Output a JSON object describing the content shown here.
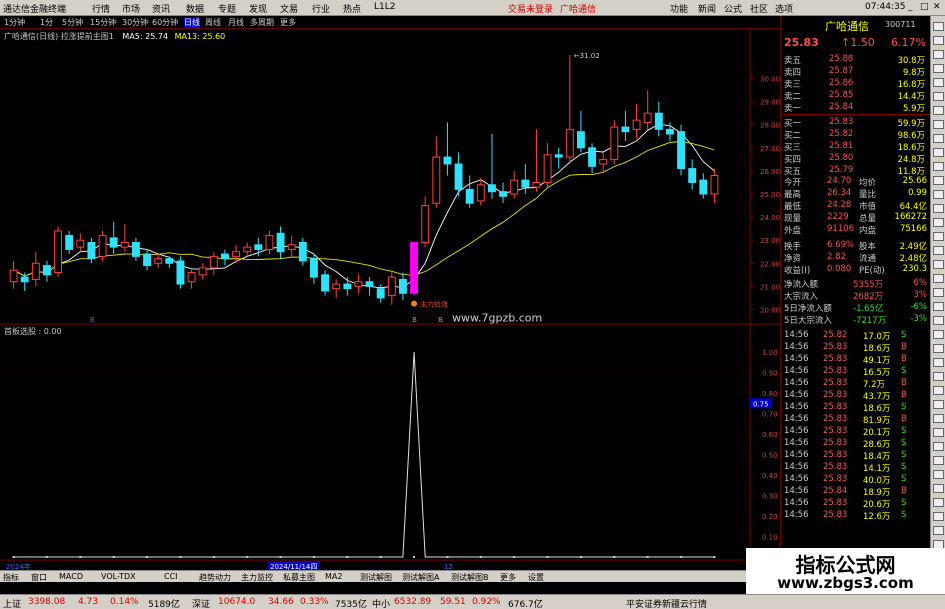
{
  "topbar": {
    "app": "通达信金融终端",
    "menu": [
      "行情",
      "市场",
      "资讯",
      "数据",
      "专题",
      "发现",
      "文易",
      "行业",
      "热点",
      "L1L2"
    ],
    "trade": "交易未登录",
    "stock": "广哈通信",
    "right": [
      "功能",
      "新闻",
      "公式",
      "社区",
      "选项"
    ],
    "clock": "07:44:35"
  },
  "tf": {
    "items": [
      "1分钟",
      "1分",
      "5分钟",
      "15分钟",
      "30分钟",
      "60分钟",
      "日线",
      "周线",
      "月线",
      "多周期",
      "更多"
    ],
    "active": "日线"
  },
  "chart_title": {
    "text": "广哈通信(日线) 拉涨提前主图1",
    "ma5": "MA5: 25.74",
    "ma13": "MA13: 25.60"
  },
  "chart_data": {
    "type": "candlestick",
    "ylim": [
      19.5,
      31.8
    ],
    "high_label": "31.02",
    "yticks": [
      "30.00",
      "29.00",
      "28.00",
      "27.00",
      "26.00",
      "25.00",
      "24.00",
      "23.00",
      "22.00",
      "21.00",
      "20.00"
    ],
    "candles": [
      [
        21.2,
        21.7,
        20.9,
        22.1
      ],
      [
        21.4,
        21.2,
        20.8,
        21.6
      ],
      [
        21.3,
        22.0,
        21.0,
        22.5
      ],
      [
        21.9,
        21.5,
        21.2,
        22.1
      ],
      [
        21.6,
        23.4,
        21.4,
        23.6
      ],
      [
        23.2,
        22.6,
        22.4,
        23.4
      ],
      [
        22.7,
        23.0,
        22.5,
        23.3
      ],
      [
        22.9,
        22.2,
        22.0,
        23.1
      ],
      [
        22.3,
        23.2,
        22.1,
        23.4
      ],
      [
        23.1,
        22.7,
        22.4,
        23.8
      ],
      [
        22.7,
        22.9,
        22.5,
        23.7
      ],
      [
        22.9,
        22.3,
        22.1,
        23.1
      ],
      [
        22.4,
        21.9,
        21.7,
        22.6
      ],
      [
        22.0,
        22.2,
        21.8,
        22.4
      ],
      [
        22.2,
        22.0,
        21.8,
        22.3
      ],
      [
        22.1,
        21.1,
        20.9,
        22.3
      ],
      [
        21.2,
        21.6,
        20.9,
        21.8
      ],
      [
        21.5,
        21.8,
        21.3,
        22.0
      ],
      [
        21.8,
        22.3,
        21.5,
        22.5
      ],
      [
        22.4,
        22.2,
        21.9,
        22.6
      ],
      [
        22.3,
        22.5,
        22.0,
        22.8
      ],
      [
        22.5,
        22.7,
        22.3,
        22.9
      ],
      [
        22.8,
        22.6,
        22.3,
        23.1
      ],
      [
        22.6,
        23.2,
        22.4,
        23.4
      ],
      [
        23.3,
        22.5,
        22.2,
        23.6
      ],
      [
        22.6,
        22.8,
        22.3,
        23.2
      ],
      [
        22.9,
        22.1,
        21.9,
        23.1
      ],
      [
        22.2,
        21.4,
        21.1,
        22.4
      ],
      [
        21.5,
        20.8,
        20.6,
        21.7
      ],
      [
        20.9,
        21.1,
        20.5,
        21.3
      ],
      [
        21.1,
        20.9,
        20.6,
        21.4
      ],
      [
        21.0,
        21.2,
        20.7,
        21.5
      ],
      [
        21.2,
        21.0,
        20.6,
        21.4
      ],
      [
        20.9,
        20.5,
        20.3,
        21.1
      ],
      [
        20.6,
        21.4,
        20.2,
        21.6
      ],
      [
        21.3,
        20.7,
        20.4,
        21.6
      ],
      [
        20.7,
        22.9,
        20.6,
        22.9
      ],
      [
        22.9,
        24.5,
        22.7,
        24.9
      ],
      [
        24.6,
        26.6,
        24.4,
        27.5
      ],
      [
        26.6,
        26.3,
        25.8,
        28.1
      ],
      [
        26.3,
        25.2,
        24.9,
        26.8
      ],
      [
        25.2,
        24.6,
        24.4,
        25.8
      ],
      [
        24.7,
        25.4,
        24.5,
        25.7
      ],
      [
        25.4,
        25.1,
        24.8,
        27.6
      ],
      [
        25.1,
        24.9,
        24.6,
        25.5
      ],
      [
        25.0,
        25.6,
        24.8,
        26.0
      ],
      [
        25.6,
        25.3,
        25.0,
        26.3
      ],
      [
        25.3,
        25.5,
        25.1,
        27.8
      ],
      [
        25.5,
        26.7,
        25.3,
        27.2
      ],
      [
        26.7,
        26.6,
        26.1,
        27.0
      ],
      [
        26.6,
        27.8,
        26.3,
        31.02
      ],
      [
        27.7,
        27.0,
        26.8,
        28.6
      ],
      [
        27.0,
        26.2,
        25.9,
        27.2
      ],
      [
        26.3,
        26.5,
        25.9,
        26.8
      ],
      [
        26.5,
        27.9,
        26.3,
        28.2
      ],
      [
        27.9,
        27.7,
        27.3,
        28.6
      ],
      [
        27.8,
        28.2,
        27.4,
        28.9
      ],
      [
        28.1,
        28.5,
        27.8,
        29.5
      ],
      [
        28.5,
        27.8,
        27.5,
        29.0
      ],
      [
        27.8,
        27.6,
        27.3,
        28.1
      ],
      [
        27.7,
        26.1,
        25.8,
        28.0
      ],
      [
        26.1,
        25.5,
        25.2,
        26.5
      ],
      [
        25.6,
        25.0,
        24.8,
        25.9
      ],
      [
        25.0,
        25.8,
        24.6,
        26.1
      ]
    ],
    "ind_yticks": [
      "1.00",
      "0.90",
      "0.80",
      "0.70",
      "0.60",
      "0.50",
      "0.40",
      "0.30",
      "0.20",
      "0.10"
    ],
    "ind_cursor": "0.75",
    "signal_index": 36,
    "signal_value": 1.0
  },
  "chart_text": {
    "signal": "主力拉涨",
    "site": "www.7gpzb.com",
    "marker1": "B",
    "marker2": "B",
    "marker3": "B"
  },
  "ind_title": {
    "text": "首板选股 : 0.00"
  },
  "dates": {
    "d1": "2024年",
    "d2": "2024/11/14四",
    "d3": "12"
  },
  "quote": {
    "name": "广哈通信",
    "code": "300711",
    "price": "25.83",
    "chg": "↑1.50",
    "pct": "6.17%"
  },
  "order_book": [
    {
      "l": "卖五",
      "p": "25.88",
      "v": "30.8万"
    },
    {
      "l": "卖四",
      "p": "25.87",
      "v": "9.8万"
    },
    {
      "l": "卖三",
      "p": "25.86",
      "v": "16.8万"
    },
    {
      "l": "卖二",
      "p": "25.85",
      "v": "14.4万"
    },
    {
      "l": "卖一",
      "p": "25.84",
      "v": "5.9万"
    },
    {
      "l": "买一",
      "p": "25.83",
      "v": "59.9万"
    },
    {
      "l": "买二",
      "p": "25.82",
      "v": "98.6万"
    },
    {
      "l": "买三",
      "p": "25.81",
      "v": "18.6万"
    },
    {
      "l": "买四",
      "p": "25.80",
      "v": "24.8万"
    },
    {
      "l": "买五",
      "p": "25.79",
      "v": "11.8万"
    }
  ],
  "stats": [
    {
      "l1": "今开",
      "v1": "24.70",
      "l2": "均价",
      "v2": "25.66"
    },
    {
      "l1": "最高",
      "v1": "26.34",
      "l2": "量比",
      "v2": "0.99"
    },
    {
      "l1": "最低",
      "v1": "24.28",
      "l2": "市值",
      "v2": "64.4亿"
    },
    {
      "l1": "现量",
      "v1": "2229",
      "l2": "总量",
      "v2": "166272"
    },
    {
      "l1": "外盘",
      "v1": "91106",
      "l2": "内盘",
      "v2": "75166"
    },
    {
      "l1": "换手",
      "v1": "6.69%",
      "l2": "股本",
      "v2": "2.49亿"
    },
    {
      "l1": "净资",
      "v1": "2.82",
      "l2": "流通",
      "v2": "2.48亿"
    },
    {
      "l1": "收益(Ⅰ)",
      "v1": "0.080",
      "l2": "PE(动)",
      "v2": "230.3"
    }
  ],
  "flows": [
    {
      "l": "净流入额",
      "v": "5355万",
      "p": "6%"
    },
    {
      "l": "大宗流入",
      "v": "2682万",
      "p": "3%"
    },
    {
      "l": "5日净流入额",
      "v": "-1.65亿",
      "p": "-6%"
    },
    {
      "l": "5日大宗流入",
      "v": "-7217万",
      "p": "-3%"
    }
  ],
  "ticks": [
    [
      "14:56",
      "25.82",
      "17.0万",
      "S"
    ],
    [
      "14:56",
      "25.83",
      "18.6万",
      "B"
    ],
    [
      "14:56",
      "25.83",
      "49.1万",
      "B"
    ],
    [
      "14:56",
      "25.83",
      "16.5万",
      "S"
    ],
    [
      "14:56",
      "25.83",
      "7.2万",
      "B"
    ],
    [
      "14:56",
      "25.83",
      "43.7万",
      "B"
    ],
    [
      "14:56",
      "25.83",
      "18.6万",
      "S"
    ],
    [
      "14:56",
      "25.83",
      "81.9万",
      "B"
    ],
    [
      "14:56",
      "25.83",
      "20.1万",
      "S"
    ],
    [
      "14:56",
      "25.83",
      "28.6万",
      "S"
    ],
    [
      "14:56",
      "25.83",
      "18.4万",
      "S"
    ],
    [
      "14:56",
      "25.83",
      "14.1万",
      "S"
    ],
    [
      "14:56",
      "25.83",
      "40.0万",
      "S"
    ],
    [
      "14:56",
      "25.84",
      "18.9万",
      "B"
    ],
    [
      "14:56",
      "25.83",
      "20.6万",
      "S"
    ],
    [
      "14:56",
      "25.83",
      "12.6万",
      "S"
    ]
  ],
  "bottomtabs": [
    "指标",
    "窗口",
    "MACD",
    "VOL-TDX",
    "CCI",
    "趋势动力",
    "主力监控",
    "私募主图",
    "MA2",
    "测试解图",
    "测试解图A",
    "测试解图B",
    "更多",
    "设置"
  ],
  "watermark": {
    "title": "指标公式网",
    "url": "www.zbgs3.com"
  },
  "status": {
    "sh": "上证",
    "sh_v": "3398.08",
    "sh_c": "4.73",
    "sh_p": "0.14%",
    "sh_a": "5189亿",
    "sz": "深证",
    "sz_v": "10674.0",
    "sz_c": "34.66",
    "sz_p": "0.33%",
    "sz_a": "7535亿",
    "zx": "中小",
    "zx_v": "6532.89",
    "zx_c": "59.51",
    "zx_p": "0.92%",
    "zx_a": "676.7亿",
    "broker": "平安证券新疆云行情"
  }
}
